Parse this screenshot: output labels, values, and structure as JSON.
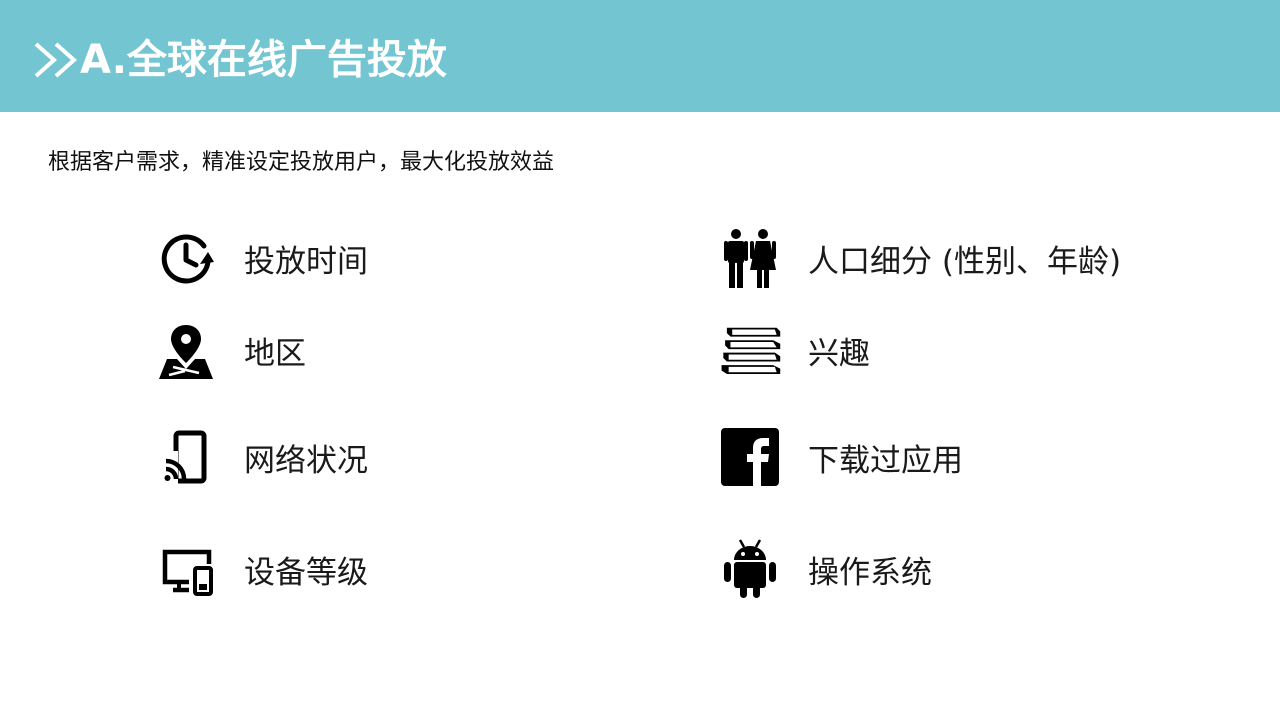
{
  "header": {
    "title": "A.全球在线广告投放",
    "background_color": "#74c5d2",
    "chevron_icon": "double-chevron-right-icon"
  },
  "subtitle": "根据客户需求，精准设定投放用户，最大化投放效益",
  "features": [
    {
      "label": "投放时间",
      "icon": "clock-history-icon"
    },
    {
      "label": "地区",
      "icon": "map-pin-icon"
    },
    {
      "label": "网络状况",
      "icon": "cast-signal-icon"
    },
    {
      "label": "设备等级",
      "icon": "devices-icon"
    },
    {
      "label": "人口细分 (性别、年龄)",
      "icon": "man-woman-icon"
    },
    {
      "label": "兴趣",
      "icon": "books-icon"
    },
    {
      "label": "下载过应用",
      "icon": "facebook-icon"
    },
    {
      "label": "操作系统",
      "icon": "android-icon"
    }
  ]
}
